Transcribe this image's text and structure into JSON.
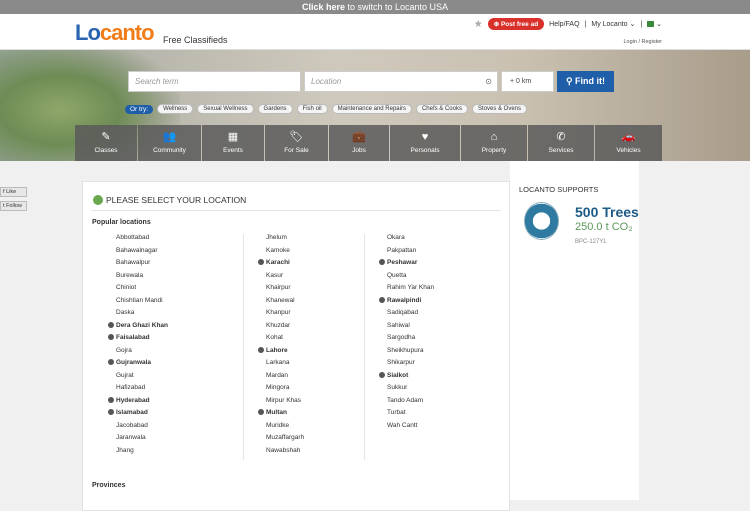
{
  "topbar": {
    "click_here": "Click here",
    "rest": " to switch to Locanto USA"
  },
  "header": {
    "logo_blue": "Lo",
    "logo_orange": "canto",
    "tagline": "Free Classifieds",
    "post_free_ad": "Post free ad",
    "help_faq": "Help/FAQ",
    "my_locanto": "My Locanto",
    "login_register": "Login / Register"
  },
  "search": {
    "term_placeholder": "Search term",
    "location_placeholder": "Location",
    "radius": "+ 0 km",
    "find_button": "Find it!"
  },
  "try": {
    "label": "Or try:",
    "tags": [
      "Wellness",
      "Sexual Wellness",
      "Gardens",
      "Fish oil",
      "Maintenance and Repairs",
      "Chefs & Cooks",
      "Stoves & Ovens"
    ]
  },
  "categories": [
    {
      "label": "Classes",
      "icon": "classes-icon"
    },
    {
      "label": "Community",
      "icon": "community-icon"
    },
    {
      "label": "Events",
      "icon": "calendar-icon"
    },
    {
      "label": "For Sale",
      "icon": "tag-icon"
    },
    {
      "label": "Jobs",
      "icon": "briefcase-icon"
    },
    {
      "label": "Personals",
      "icon": "heart-icon"
    },
    {
      "label": "Property",
      "icon": "house-icon"
    },
    {
      "label": "Services",
      "icon": "phone-icon"
    },
    {
      "label": "Vehicles",
      "icon": "car-icon"
    }
  ],
  "social": {
    "like": "Like",
    "follow": "Follow"
  },
  "location_panel": {
    "title": "PLEASE SELECT YOUR LOCATION",
    "popular_label": "Popular locations",
    "provinces_label": "Provinces",
    "columns": [
      [
        {
          "name": "Abbottabad",
          "major": false
        },
        {
          "name": "Bahawalnagar",
          "major": false
        },
        {
          "name": "Bahawalpur",
          "major": false
        },
        {
          "name": "Burewala",
          "major": false
        },
        {
          "name": "Chiniot",
          "major": false
        },
        {
          "name": "Chishtian Mandi",
          "major": false
        },
        {
          "name": "Daska",
          "major": false
        },
        {
          "name": "Dera Ghazi Khan",
          "major": true
        },
        {
          "name": "Faisalabad",
          "major": true
        },
        {
          "name": "Gojra",
          "major": false
        },
        {
          "name": "Gujranwala",
          "major": true
        },
        {
          "name": "Gujrat",
          "major": false
        },
        {
          "name": "Hafizabad",
          "major": false
        },
        {
          "name": "Hyderabad",
          "major": true
        },
        {
          "name": "Islamabad",
          "major": true
        },
        {
          "name": "Jacobabad",
          "major": false
        },
        {
          "name": "Jaranwala",
          "major": false
        },
        {
          "name": "Jhang",
          "major": false
        }
      ],
      [
        {
          "name": "Jhelum",
          "major": false
        },
        {
          "name": "Kamoke",
          "major": false
        },
        {
          "name": "Karachi",
          "major": true
        },
        {
          "name": "Kasur",
          "major": false
        },
        {
          "name": "Khairpur",
          "major": false
        },
        {
          "name": "Khanewal",
          "major": false
        },
        {
          "name": "Khanpur",
          "major": false
        },
        {
          "name": "Khuzdar",
          "major": false
        },
        {
          "name": "Kohat",
          "major": false
        },
        {
          "name": "Lahore",
          "major": true
        },
        {
          "name": "Larkana",
          "major": false
        },
        {
          "name": "Mardan",
          "major": false
        },
        {
          "name": "Mingora",
          "major": false
        },
        {
          "name": "Mirpur Khas",
          "major": false
        },
        {
          "name": "Multan",
          "major": true
        },
        {
          "name": "Muridke",
          "major": false
        },
        {
          "name": "Muzaffargarh",
          "major": false
        },
        {
          "name": "Nawabshah",
          "major": false
        }
      ],
      [
        {
          "name": "Okara",
          "major": false
        },
        {
          "name": "Pakpattan",
          "major": false
        },
        {
          "name": "Peshawar",
          "major": true
        },
        {
          "name": "Quetta",
          "major": false
        },
        {
          "name": "Rahim Yar Khan",
          "major": false
        },
        {
          "name": "Rawalpindi",
          "major": true
        },
        {
          "name": "Sadiqabad",
          "major": false
        },
        {
          "name": "Sahiwal",
          "major": false
        },
        {
          "name": "Sargodha",
          "major": false
        },
        {
          "name": "Sheikhupura",
          "major": false
        },
        {
          "name": "Shikarpur",
          "major": false
        },
        {
          "name": "Sialkot",
          "major": true
        },
        {
          "name": "Sukkur",
          "major": false
        },
        {
          "name": "Tando Adam",
          "major": false
        },
        {
          "name": "Turbat",
          "major": false
        },
        {
          "name": "Wah Cantt",
          "major": false
        }
      ]
    ]
  },
  "sidebar": {
    "title": "LOCANTO SUPPORTS",
    "trees": "500 Trees",
    "co2": "250.0 t CO₂",
    "code": "BPC-127YL"
  }
}
